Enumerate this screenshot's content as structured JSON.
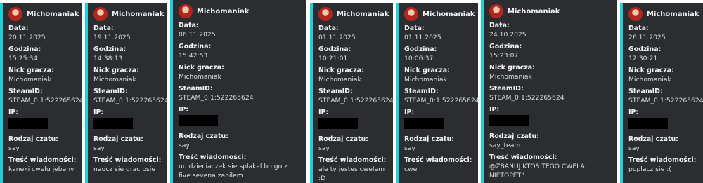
{
  "labels": {
    "data": "Data:",
    "godzina": "Godzina:",
    "nick": "Nick gracza:",
    "steamid": "SteamID:",
    "ip": "IP:",
    "rodzaj": "Rodzaj czatu:",
    "tresc": "Treść wiadomości:"
  },
  "colors": {
    "accent": "#1fcfd9",
    "card_bg": "#2b2d31",
    "redaction": "#000000"
  },
  "cards": [
    {
      "author": "Michomaniak",
      "date": "20.11.2025",
      "time": "15:25:34",
      "nick": "Michomaniak",
      "steamid": "STEAM_0:1:522265624",
      "ip_redacted": true,
      "chat_type": "say",
      "message": "kaneki cwelu jebany"
    },
    {
      "author": "Michomaniak",
      "date": "19.11.2025",
      "time": "14:38:13",
      "nick": "Michomaniak",
      "steamid": "STEAM_0:1:522265624",
      "ip_redacted": true,
      "chat_type": "say",
      "message": "naucz sie grac psie"
    },
    {
      "author": "Michomaniak",
      "date": "06.11.2025",
      "time": "15:42:53",
      "nick": "Michomaniak",
      "steamid": "STEAM_0:1:522265624",
      "ip_redacted": true,
      "chat_type": "say",
      "message": "uu dzieciaczek sie splakal bo go z five sevena zabilem"
    },
    {
      "author": "Michomaniak",
      "date": "01.11.2025",
      "time": "10:21:01",
      "nick": "Michomaniak",
      "steamid": "STEAM_0:1:522265624",
      "ip_redacted": true,
      "chat_type": "say",
      "message": "ale ty jestes cwelem :D"
    },
    {
      "author": "Michomaniak",
      "date": "01.11.2025",
      "time": "10:06:37",
      "nick": "Michomaniak",
      "steamid": "STEAM_0:1:522265624",
      "ip_redacted": true,
      "chat_type": "say",
      "message": "cwel"
    },
    {
      "author": "Michomaniak",
      "date": "24.10.2025",
      "time": "15:23:07",
      "nick": "Michomaniak",
      "steamid": "STEAM_0:1:522265624",
      "ip_redacted": true,
      "chat_type": "say_team",
      "message": "@ZBANUJ KTOS TEGO CWELA NIETOPET\""
    },
    {
      "author": "Michomaniak",
      "date": "26.11.2025",
      "time": "12:30:21",
      "nick": "Michomaniak",
      "steamid": "STEAM_0:1:522265624",
      "ip_redacted": true,
      "chat_type": "say",
      "message": "poplacz sie :("
    }
  ]
}
